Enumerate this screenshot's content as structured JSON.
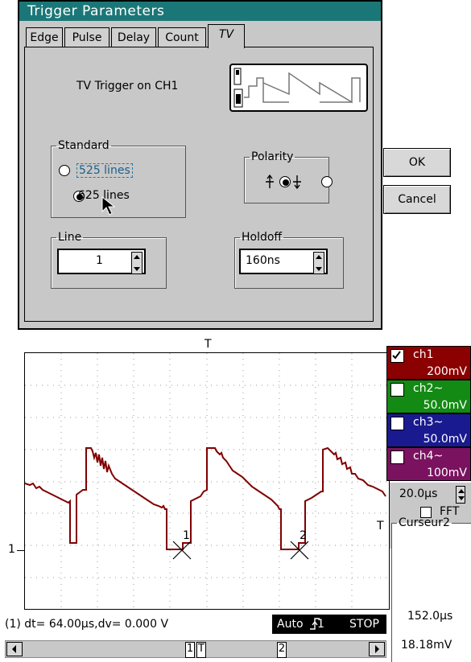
{
  "dialog": {
    "title": "Trigger Parameters",
    "tabs": [
      {
        "label": "Edge"
      },
      {
        "label": "Pulse"
      },
      {
        "label": "Delay"
      },
      {
        "label": "Count"
      },
      {
        "label": "TV"
      }
    ],
    "active_tab": "TV",
    "tv_caption": "TV Trigger on CH1",
    "standard": {
      "legend": "Standard",
      "options": [
        {
          "label": "525 lines",
          "selected": false
        },
        {
          "label": "625 lines",
          "selected": true
        }
      ]
    },
    "polarity": {
      "legend": "Polarity",
      "selected": "positive"
    },
    "line": {
      "legend": "Line",
      "value": "1"
    },
    "holdoff": {
      "legend": "Holdoff",
      "value": "160ns"
    },
    "ok_label": "OK",
    "cancel_label": "Cancel"
  },
  "scope": {
    "trigger_marker": "T",
    "ground_marker": "1",
    "channels": [
      {
        "label": "ch1",
        "value": "200mV",
        "checked": true,
        "color": "#8b0000"
      },
      {
        "label": "ch2~",
        "value": "50.0mV",
        "checked": false,
        "color": "#138a13"
      },
      {
        "label": "ch3~",
        "value": "50.0mV",
        "checked": false,
        "color": "#1a1a90"
      },
      {
        "label": "ch4~",
        "value": "100mV",
        "checked": false,
        "color": "#7a1260"
      }
    ],
    "timebase": "20.0µs",
    "fft_label": "FFT",
    "cursor_panel": {
      "legend": "Curseur2",
      "time": "152.0µs",
      "volt": "18.18mV"
    },
    "measurement": "(1) dt=  64.00µs,dv=  0.000 V",
    "status": {
      "mode": "Auto",
      "state": "STOP"
    },
    "cursor_labels": [
      "1",
      "2"
    ],
    "bottom_markers": [
      "1",
      "T",
      "2"
    ]
  }
}
